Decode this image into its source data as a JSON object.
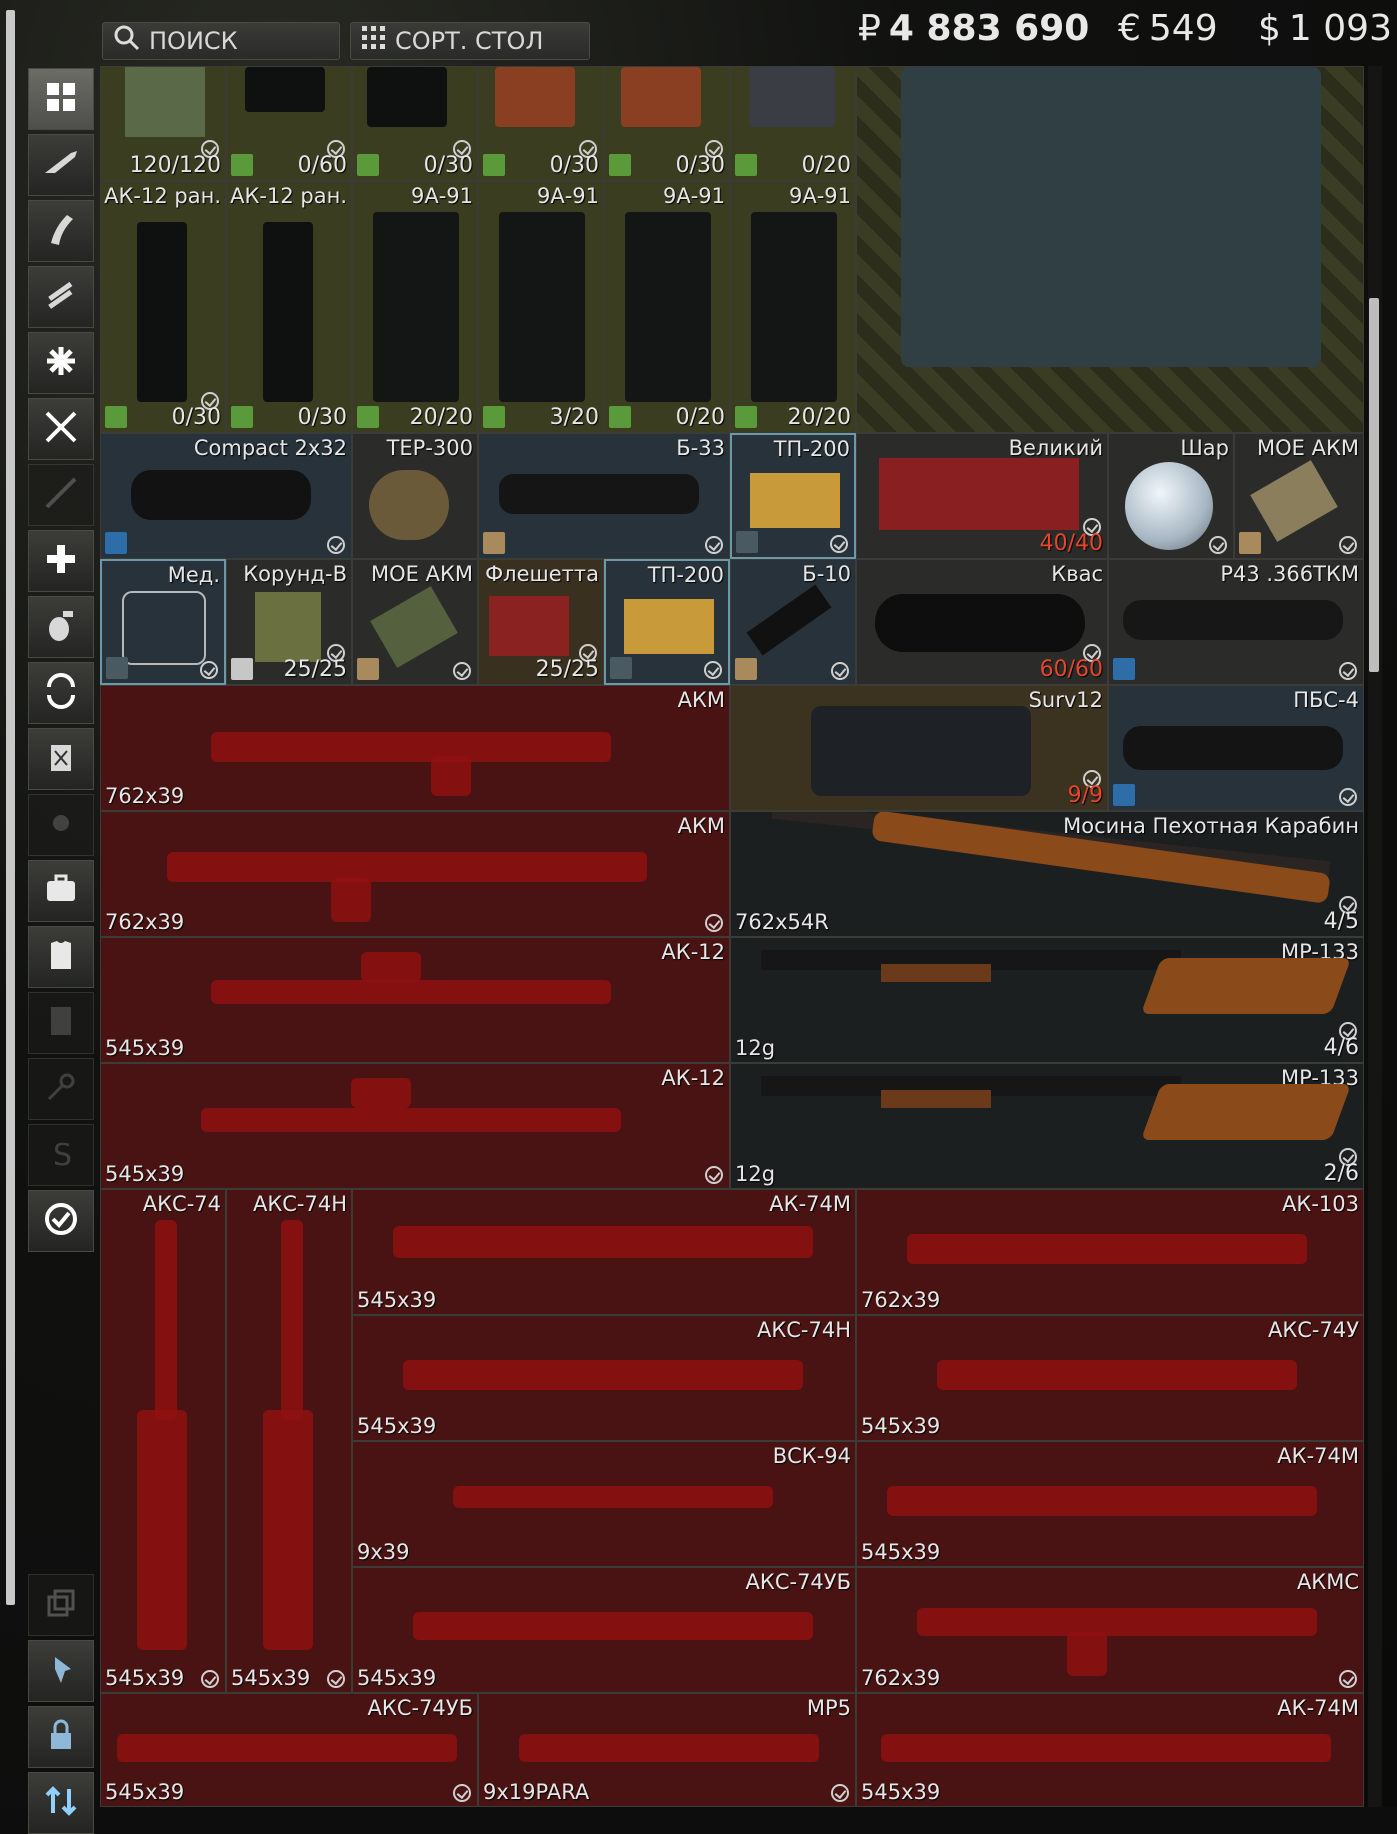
{
  "topbar": {
    "search_label": "ПОИСК",
    "sort_label": "СОРТ. СТОЛ",
    "roubles": "4 883 690",
    "euros": "549",
    "dollars": "1 093",
    "rouble_symbol": "₽",
    "euro_symbol": "€",
    "dollar_symbol": "$"
  },
  "sidebar": {
    "icons": [
      "grid-icon",
      "rifle-icon",
      "magazine-icon",
      "ammo-icon",
      "gear-mod-icon",
      "knife-icon",
      "barrel-icon",
      "medical-icon",
      "grenade-icon",
      "barter-icon",
      "rig-icon",
      "marker-icon",
      "briefcase-icon",
      "armor-icon",
      "notes-icon",
      "keys-icon",
      "info-icon",
      "check-icon",
      "copy-icon",
      "pin-icon",
      "lock-icon",
      "sort-arrows-icon"
    ]
  },
  "grid": {
    "row1": [
      {
        "label": "",
        "count": "120/120"
      },
      {
        "label": "",
        "count": "0/60"
      },
      {
        "label": "",
        "count": "0/30"
      },
      {
        "label": "",
        "count": "0/30"
      },
      {
        "label": "",
        "count": "0/30"
      },
      {
        "label": "",
        "count": "0/20"
      }
    ],
    "row2": [
      {
        "label": "АК-12 ран.",
        "count": "0/30"
      },
      {
        "label": "АК-12 ран.",
        "count": "0/30"
      },
      {
        "label": "9А-91",
        "count": "20/20"
      },
      {
        "label": "9А-91",
        "count": "3/20"
      },
      {
        "label": "9А-91",
        "count": "0/20"
      },
      {
        "label": "9А-91",
        "count": "20/20"
      }
    ],
    "row3": [
      {
        "label": "Compact 2x32",
        "count": ""
      },
      {
        "label": "ТЕР-300",
        "count": ""
      },
      {
        "label": "Б-33",
        "count": ""
      },
      {
        "label": "ТП-200",
        "count": ""
      },
      {
        "label": "Великий",
        "count": "40/40"
      },
      {
        "label": "Шар",
        "count": ""
      },
      {
        "label": "МОЕ АКМ",
        "count": ""
      }
    ],
    "row4": [
      {
        "label": "Мед.",
        "count": ""
      },
      {
        "label": "Корунд-В",
        "count": "25/25"
      },
      {
        "label": "МОЕ АКМ",
        "count": ""
      },
      {
        "label": "Флешетта",
        "count": "25/25"
      },
      {
        "label": "ТП-200",
        "count": ""
      },
      {
        "label": "Б-10",
        "count": ""
      },
      {
        "label": "Квас",
        "count": "60/60"
      },
      {
        "label": "Р43 .366ТКМ",
        "count": ""
      }
    ],
    "row5": [
      {
        "label": "АКМ",
        "ammo": "762x39",
        "count": ""
      },
      {
        "label": "Surv12",
        "ammo": "",
        "count": "9/9"
      },
      {
        "label": "ПБС-4",
        "ammo": "",
        "count": ""
      }
    ],
    "row6": [
      {
        "label": "АКМ",
        "ammo": "762x39",
        "count": ""
      },
      {
        "label": "Мосина Пехотная Карабин",
        "ammo": "762x54R",
        "count": "4/5"
      }
    ],
    "row7": [
      {
        "label": "АК-12",
        "ammo": "545x39",
        "count": ""
      },
      {
        "label": "MP-133",
        "ammo": "12g",
        "count": "4/6"
      }
    ],
    "row8": [
      {
        "label": "АК-12",
        "ammo": "545x39",
        "count": ""
      },
      {
        "label": "MP-133",
        "ammo": "12g",
        "count": "2/6"
      }
    ],
    "tall": [
      {
        "label": "АКС-74",
        "ammo": "545x39"
      },
      {
        "label": "АКС-74Н",
        "ammo": "545x39"
      }
    ],
    "row9": [
      {
        "label": "АК-74М",
        "ammo": "545x39"
      },
      {
        "label": "АК-103",
        "ammo": "762x39"
      }
    ],
    "row10": [
      {
        "label": "АКС-74Н",
        "ammo": "545x39"
      },
      {
        "label": "АКС-74У",
        "ammo": "545x39"
      }
    ],
    "row11": [
      {
        "label": "ВСК-94",
        "ammo": "9x39"
      },
      {
        "label": "АК-74М",
        "ammo": "545x39"
      }
    ],
    "row12": [
      {
        "label": "АКС-74УБ",
        "ammo": "545x39"
      },
      {
        "label": "АКМС",
        "ammo": "762x39"
      }
    ],
    "row13": [
      {
        "label": "АКС-74УБ",
        "ammo": "545x39"
      },
      {
        "label": "MP5",
        "ammo": "9x19PARA"
      },
      {
        "label": "АК-74М",
        "ammo": "545x39"
      }
    ]
  }
}
